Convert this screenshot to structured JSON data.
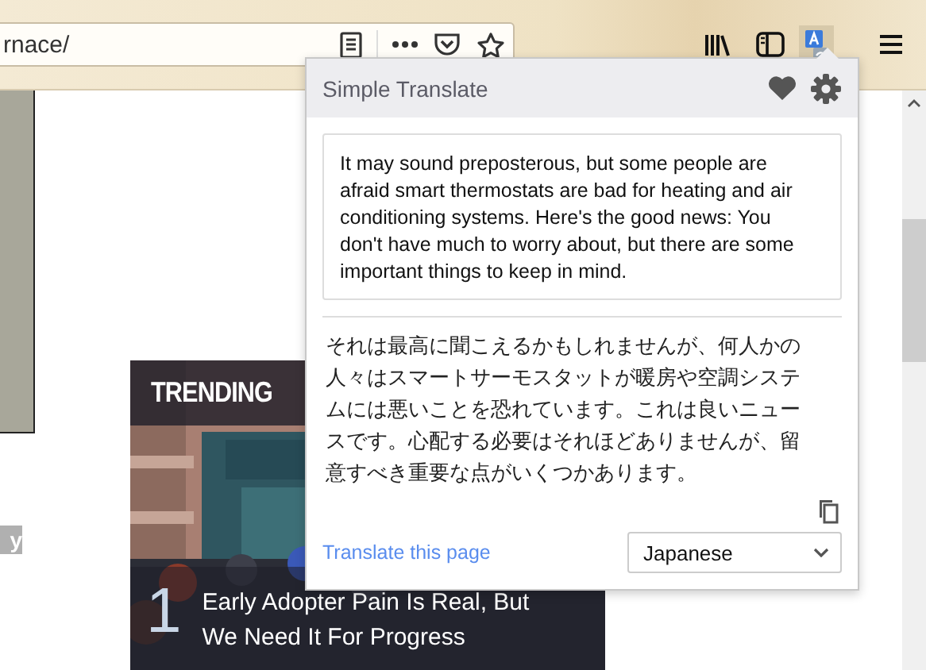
{
  "toolbar": {
    "url": "rnace/"
  },
  "page": {
    "side_label": "y",
    "trending": {
      "heading": "TRENDING",
      "number": "1",
      "title": "Early Adopter Pain Is Real, But We Need It For Progress"
    }
  },
  "popup": {
    "title": "Simple Translate",
    "source_text": "It may sound preposterous, but some people are afraid smart thermostats are bad for heating and air conditioning systems. Here's the good news: You don't have much to worry about, but there are some important things to keep in mind.",
    "translation": "それは最高に聞こえるかもしれませんが、何人かの人々はスマートサーモスタットが暖房や空調システムには悪いことを恐れています。これは良いニュースです。心配する必要はそれほどありませんが、留意すべき重要な点がいくつかあります。",
    "link": "Translate this page",
    "language": "Japanese"
  }
}
